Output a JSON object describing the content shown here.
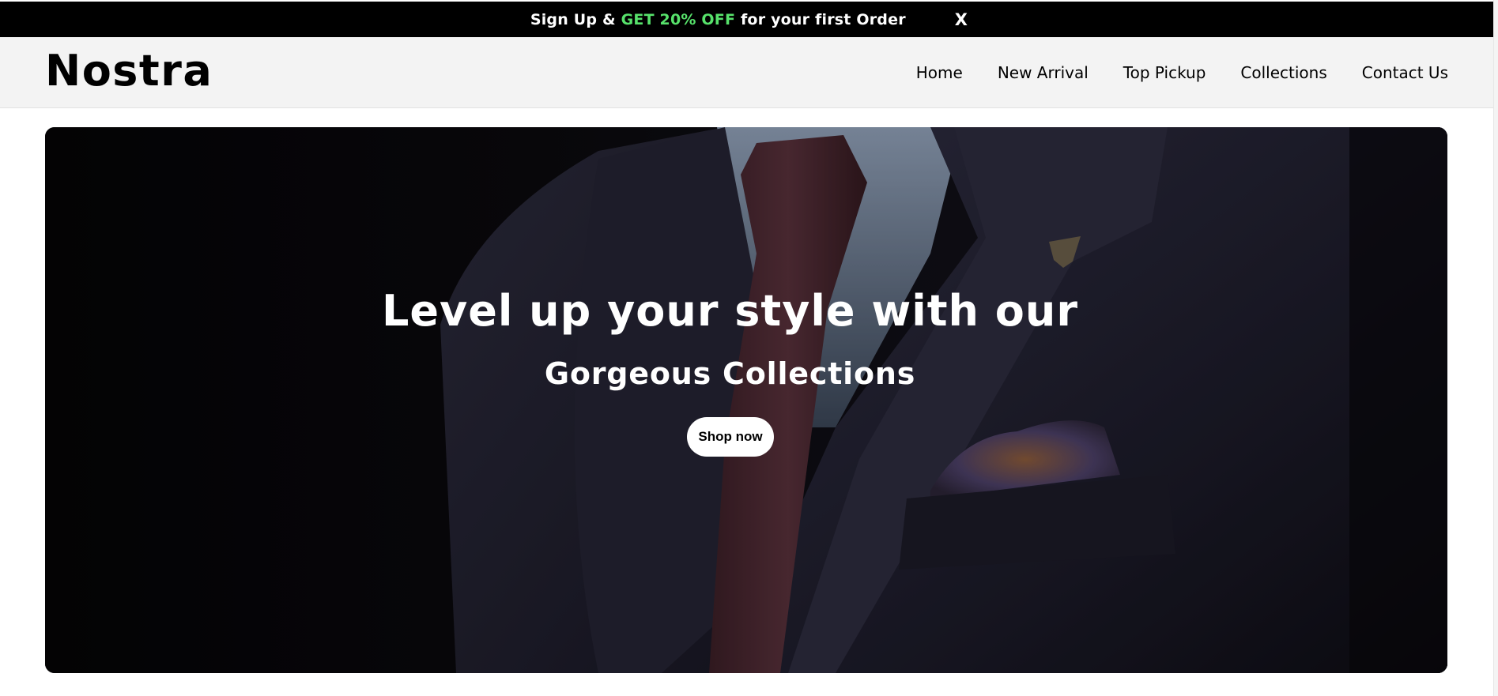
{
  "announcement": {
    "prefix": "Sign Up & ",
    "highlight": "GET 20% OFF",
    "suffix": " for your first Order",
    "close_label": "X",
    "highlight_color": "#57e26b"
  },
  "header": {
    "logo": "Nostra",
    "nav": [
      {
        "label": "Home"
      },
      {
        "label": "New Arrival"
      },
      {
        "label": "Top Pickup"
      },
      {
        "label": "Collections"
      },
      {
        "label": "Contact Us"
      }
    ]
  },
  "hero": {
    "title": "Level up your style with our",
    "subtitle": "Gorgeous Collections",
    "cta_label": "Shop now",
    "image_subject": "suit-jacket-tie-photo"
  }
}
